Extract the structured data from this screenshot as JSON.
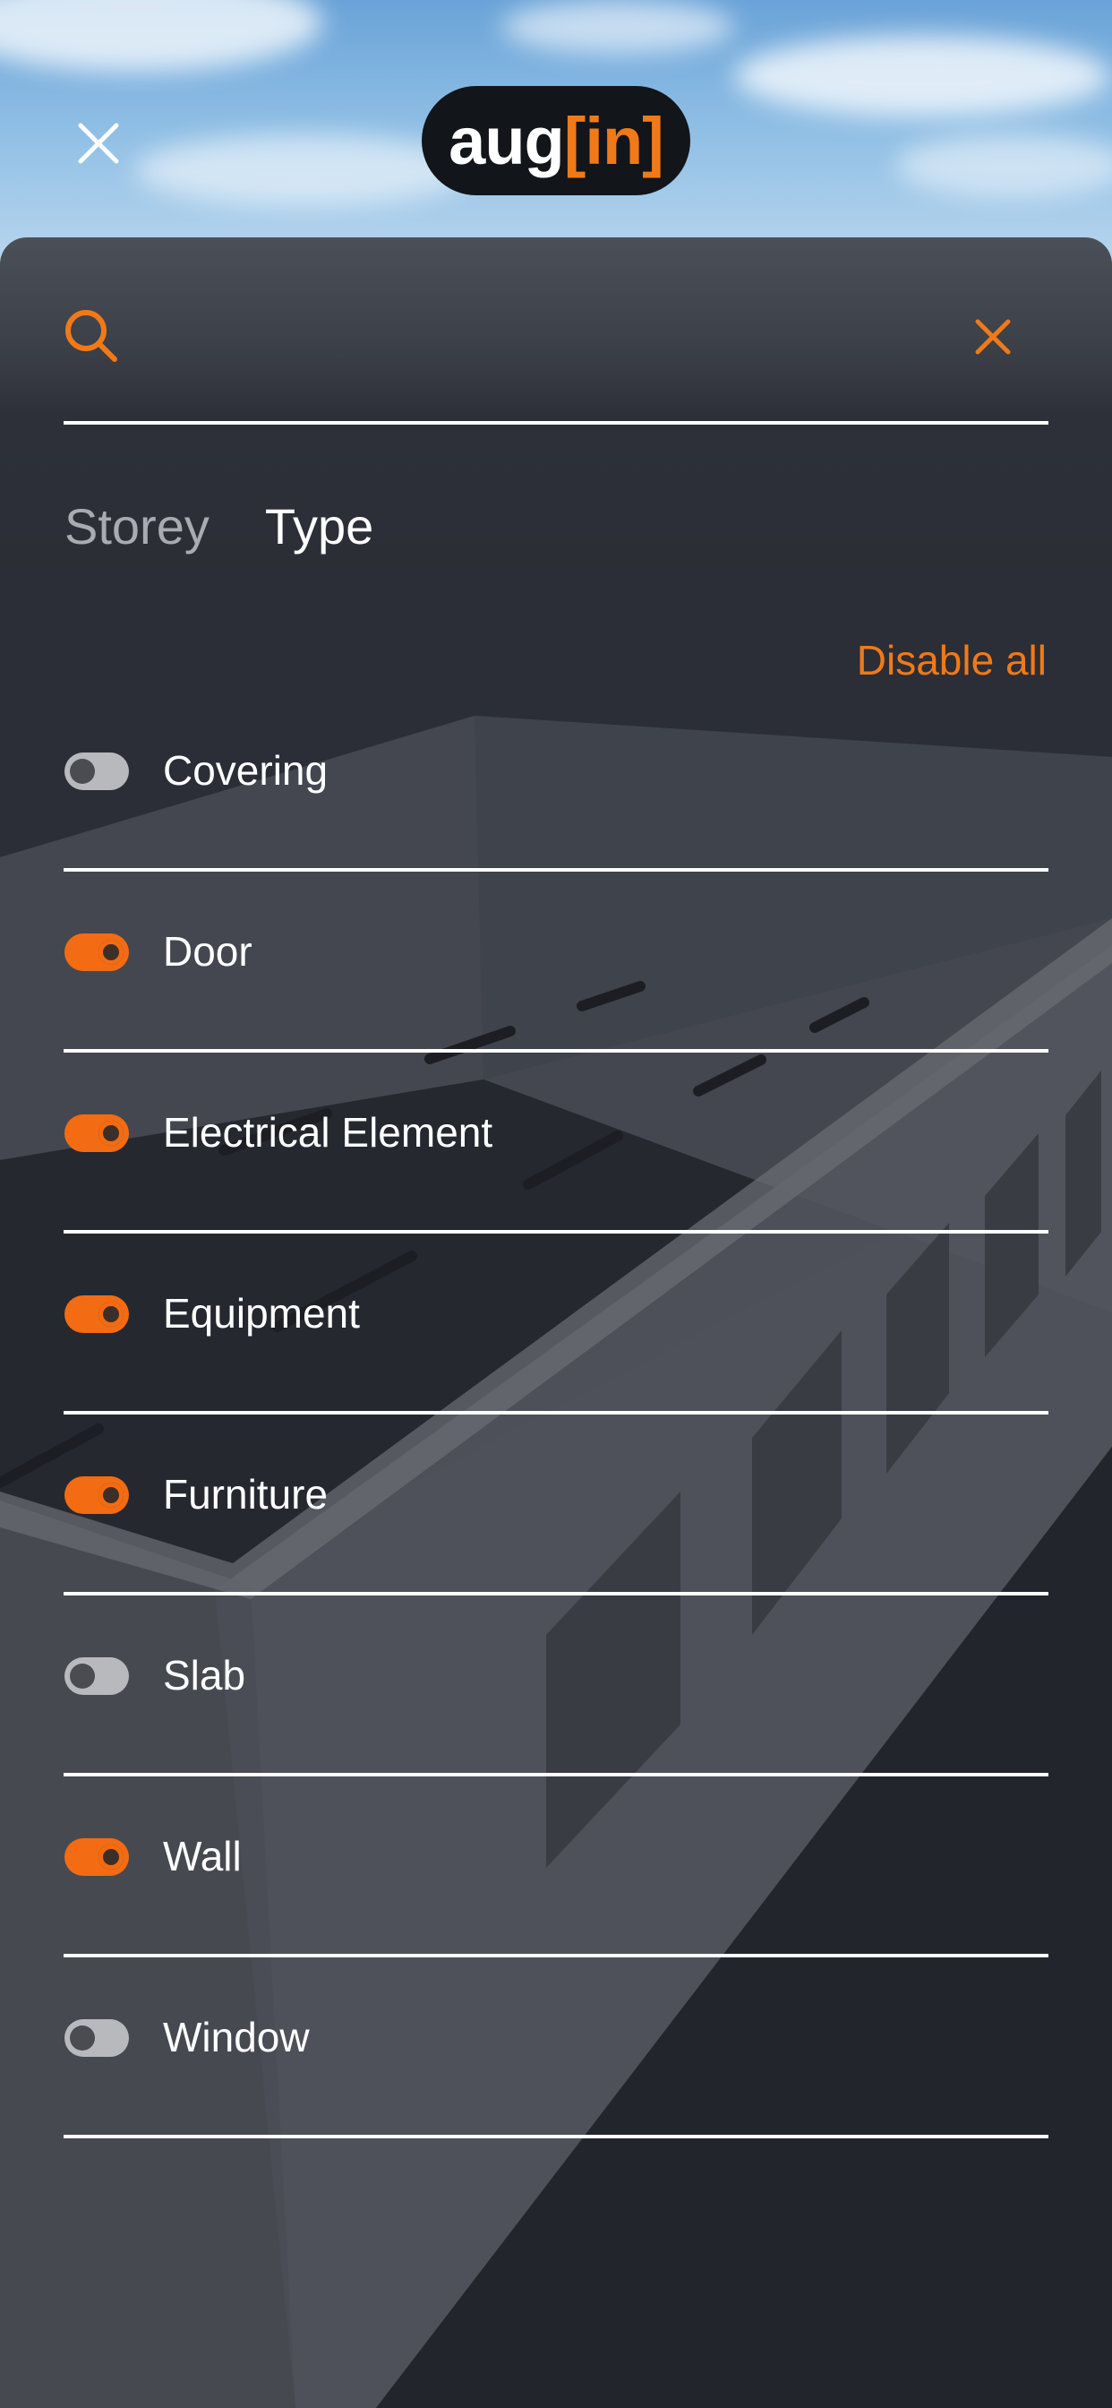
{
  "header": {
    "logo_text": "aug",
    "logo_bracket_open": "[",
    "logo_i": "i",
    "logo_n": "n",
    "logo_bracket_close": "]",
    "accent_color": "#f07a18"
  },
  "search": {
    "value": "",
    "placeholder": ""
  },
  "tabs": [
    {
      "label": "Storey",
      "active": false
    },
    {
      "label": "Type",
      "active": true
    }
  ],
  "actions": {
    "disable_all": "Disable all"
  },
  "types": [
    {
      "label": "Covering",
      "enabled": false
    },
    {
      "label": "Door",
      "enabled": true
    },
    {
      "label": "Electrical Element",
      "enabled": true
    },
    {
      "label": "Equipment",
      "enabled": true
    },
    {
      "label": "Furniture",
      "enabled": true
    },
    {
      "label": "Slab",
      "enabled": false
    },
    {
      "label": "Wall",
      "enabled": true
    },
    {
      "label": "Window",
      "enabled": false
    }
  ]
}
